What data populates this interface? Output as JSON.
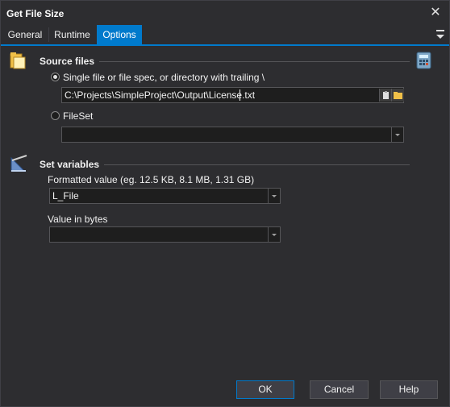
{
  "window": {
    "title": "Get File Size"
  },
  "tabs": [
    {
      "label": "General"
    },
    {
      "label": "Runtime"
    },
    {
      "label": "Options"
    }
  ],
  "source_files": {
    "title": "Source files",
    "option_single_label": "Single file or file spec, or directory with trailing \\",
    "path_value": "C:\\Projects\\SimpleProject\\Output\\License.txt",
    "option_fileset_label": "FileSet",
    "fileset_value": ""
  },
  "set_variables": {
    "title": "Set variables",
    "formatted_label": "Formatted value (eg. 12.5 KB, 8.1 MB, 1.31 GB)",
    "formatted_value": "L_File",
    "bytes_label": "Value in bytes",
    "bytes_value": ""
  },
  "buttons": {
    "ok": "OK",
    "cancel": "Cancel",
    "help": "Help"
  },
  "colors": {
    "accent": "#007acc",
    "background": "#2d2d30"
  }
}
